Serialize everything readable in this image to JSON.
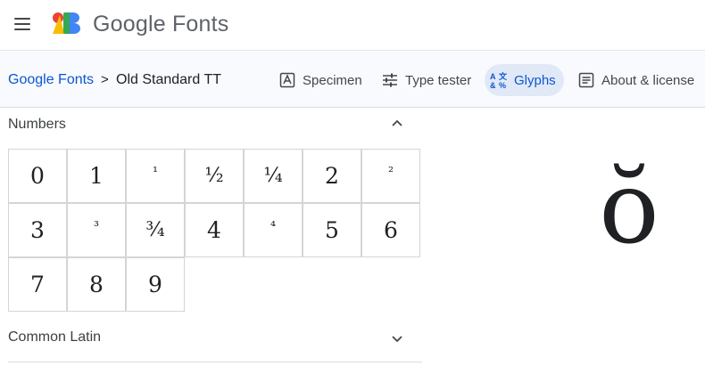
{
  "header": {
    "brand": "Google Fonts",
    "menu_icon": "hamburger-icon",
    "logo_icon": "google-fonts-logo",
    "logo_colors": [
      "#ea4335",
      "#fbbc04",
      "#34a853",
      "#4285f4"
    ]
  },
  "breadcrumb": {
    "root": "Google Fonts",
    "separator": ">",
    "current": "Old Standard TT"
  },
  "tabs": [
    {
      "label": "Specimen",
      "icon": "specimen-icon",
      "active": false
    },
    {
      "label": "Type tester",
      "icon": "tune-icon",
      "active": false
    },
    {
      "label": "Glyphs",
      "icon": "glyphs-icon",
      "active": true
    },
    {
      "label": "About & license",
      "icon": "article-icon",
      "active": false
    }
  ],
  "sections": {
    "numbers": {
      "title": "Numbers",
      "expanded": true
    },
    "common_latin": {
      "title": "Common Latin",
      "expanded": false
    }
  },
  "glyphs": [
    "0",
    "1",
    "¹",
    "½",
    "¼",
    "2",
    "²",
    "3",
    "³",
    "¾",
    "4",
    "⁴",
    "5",
    "6",
    "7",
    "8",
    "9"
  ],
  "preview_glyph": "ŏ",
  "colors": {
    "accent": "#0b57d0",
    "active_tab_bg": "#e1e9f7",
    "subnav_bg": "#f8fafd"
  }
}
